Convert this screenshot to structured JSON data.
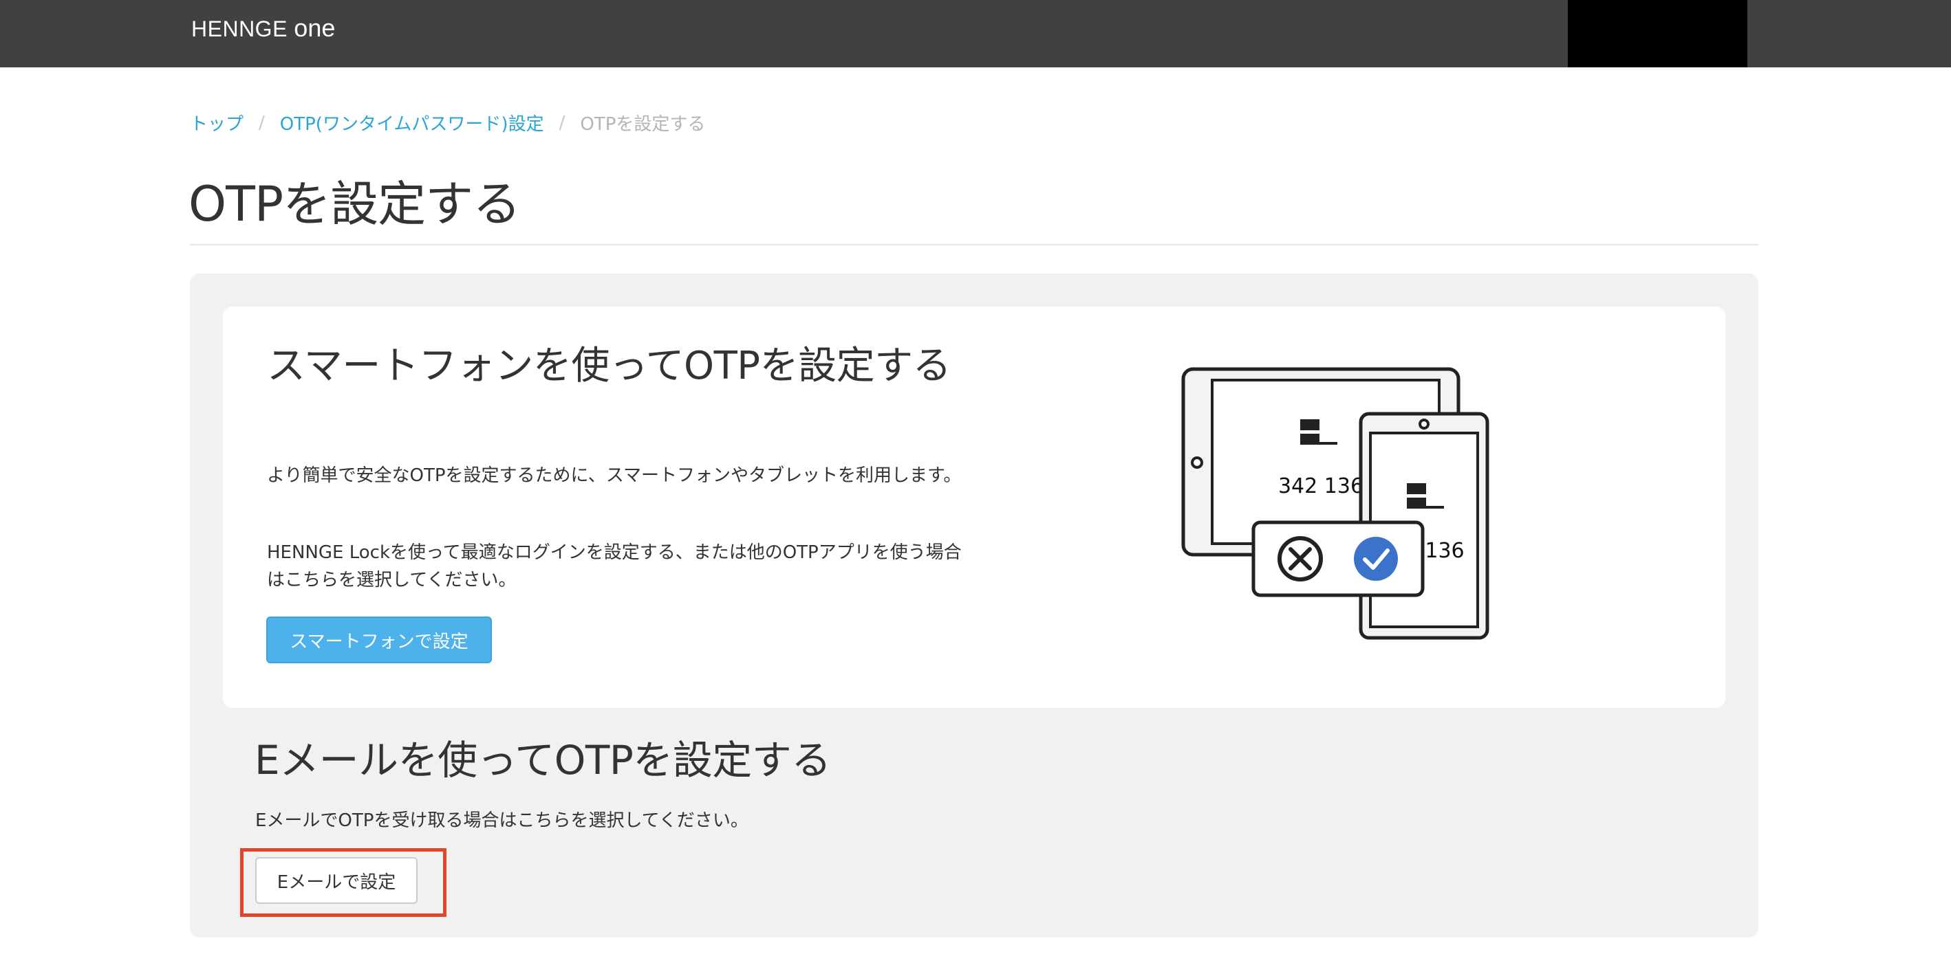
{
  "header": {
    "logo_main": "HENNGE ",
    "logo_suffix": "one"
  },
  "breadcrumb": {
    "items": [
      {
        "label": "トップ"
      },
      {
        "label": "OTP(ワンタイムパスワード)設定"
      },
      {
        "label": "OTPを設定する"
      }
    ],
    "separator": "/"
  },
  "page": {
    "title": "OTPを設定する"
  },
  "smartphone_section": {
    "heading": "スマートフォンを使ってOTPを設定する",
    "description1": "より簡単で安全なOTPを設定するために、スマートフォンやタブレットを利用します。",
    "description2": "HENNGE Lockを使って最適なログインを設定する、または他のOTPアプリを使う場合はこちらを選択してください。",
    "button_label": "スマートフォンで設定",
    "illustration": {
      "tablet_code": "342 136",
      "phone_code": "136",
      "icons": [
        "reject-icon",
        "approve-icon"
      ],
      "approve_color": "#3a73c9"
    }
  },
  "email_section": {
    "heading": "Eメールを使ってOTPを設定する",
    "description": "EメールでOTPを受け取る場合はこちらを選択してください。",
    "button_label": "Eメールで設定",
    "highlight_color": "#e0462a"
  },
  "colors": {
    "topbar": "#414141",
    "link": "#2aa4d6",
    "primary_button": "#4db2ec"
  }
}
